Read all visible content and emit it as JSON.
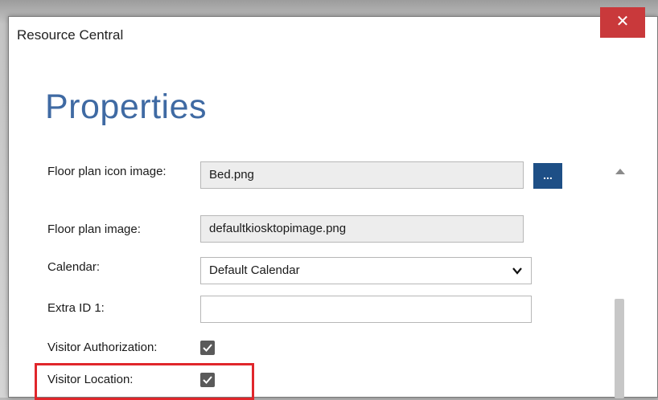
{
  "window": {
    "title": "Resource Central",
    "close_glyph": "✕"
  },
  "page": {
    "title": "Properties"
  },
  "form": {
    "floor_plan_icon": {
      "label": "Floor plan icon image:",
      "value": "Bed.png",
      "browse_label": "..."
    },
    "floor_plan_image": {
      "label": "Floor plan image:",
      "value": "defaultkiosktopimage.png"
    },
    "calendar": {
      "label": "Calendar:",
      "value": "Default Calendar"
    },
    "extra_id_1": {
      "label": "Extra ID 1:",
      "value": ""
    },
    "visitor_authorization": {
      "label": "Visitor Authorization:",
      "checked": true
    },
    "visitor_location": {
      "label": "Visitor Location:",
      "checked": true
    }
  },
  "colors": {
    "accent": "#3f6aa3",
    "button": "#1e4f86",
    "close": "#c9393b",
    "highlight": "#e0262b"
  },
  "icons": {
    "close": "close-icon",
    "chevron": "chevron-down-icon",
    "checkmark": "checkmark-icon",
    "scroll_up": "scroll-up-arrow-icon"
  }
}
